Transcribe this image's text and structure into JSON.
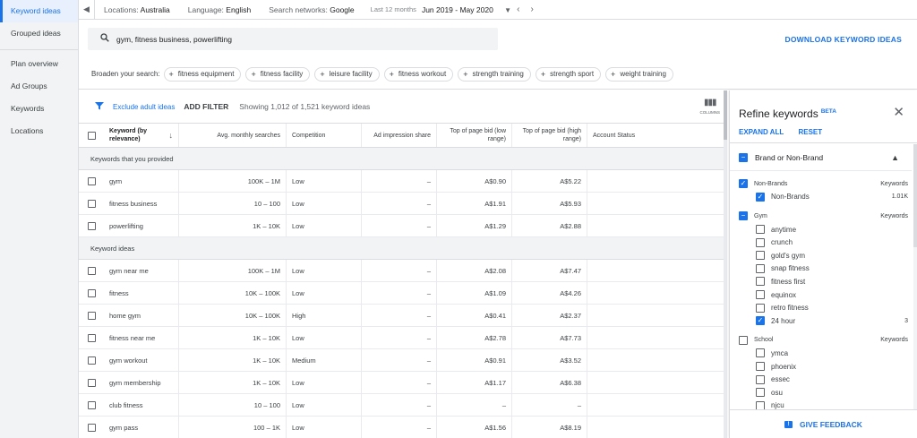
{
  "sidebar": {
    "items": [
      {
        "label": "Keyword ideas",
        "active": true
      },
      {
        "label": "Grouped ideas",
        "active": false
      },
      {
        "label": "Plan overview",
        "active": false
      },
      {
        "label": "Ad Groups",
        "active": false
      },
      {
        "label": "Keywords",
        "active": false
      },
      {
        "label": "Locations",
        "active": false
      }
    ]
  },
  "topbar": {
    "locations_key": "Locations:",
    "locations_val": "Australia",
    "language_key": "Language:",
    "language_val": "English",
    "networks_key": "Search networks:",
    "networks_val": "Google",
    "range_label": "Last 12 months",
    "range_value": "Jun 2019 - May 2020"
  },
  "search": {
    "value": "gym, fitness business, powerlifting"
  },
  "download_label": "DOWNLOAD KEYWORD IDEAS",
  "broaden": {
    "label": "Broaden your search:",
    "chips": [
      "fitness equipment",
      "fitness facility",
      "leisure facility",
      "fitness workout",
      "strength training",
      "strength sport",
      "weight training"
    ]
  },
  "filterbar": {
    "adult": "Exclude adult ideas",
    "add_filter": "ADD FILTER",
    "showing": "Showing 1,012 of 1,521 keyword ideas",
    "columns": "COLUMNS"
  },
  "table": {
    "headers": {
      "keyword": "Keyword (by relevance)",
      "searches": "Avg. monthly searches",
      "competition": "Competition",
      "impression": "Ad impression share",
      "bid_low": "Top of page bid (low range)",
      "bid_high": "Top of page bid (high range)",
      "status": "Account Status"
    },
    "group1": "Keywords that you provided",
    "provided": [
      {
        "kw": "gym",
        "s": "100K – 1M",
        "c": "Low",
        "i": "–",
        "lo": "A$0.90",
        "hi": "A$5.22"
      },
      {
        "kw": "fitness business",
        "s": "10 – 100",
        "c": "Low",
        "i": "–",
        "lo": "A$1.91",
        "hi": "A$5.93"
      },
      {
        "kw": "powerlifting",
        "s": "1K – 10K",
        "c": "Low",
        "i": "–",
        "lo": "A$1.29",
        "hi": "A$2.88"
      }
    ],
    "group2": "Keyword ideas",
    "ideas": [
      {
        "kw": "gym near me",
        "s": "100K – 1M",
        "c": "Low",
        "i": "–",
        "lo": "A$2.08",
        "hi": "A$7.47"
      },
      {
        "kw": "fitness",
        "s": "10K – 100K",
        "c": "Low",
        "i": "–",
        "lo": "A$1.09",
        "hi": "A$4.26"
      },
      {
        "kw": "home gym",
        "s": "10K – 100K",
        "c": "High",
        "i": "–",
        "lo": "A$0.41",
        "hi": "A$2.37"
      },
      {
        "kw": "fitness near me",
        "s": "1K – 10K",
        "c": "Low",
        "i": "–",
        "lo": "A$2.78",
        "hi": "A$7.73"
      },
      {
        "kw": "gym workout",
        "s": "1K – 10K",
        "c": "Medium",
        "i": "–",
        "lo": "A$0.91",
        "hi": "A$3.52"
      },
      {
        "kw": "gym membership",
        "s": "1K – 10K",
        "c": "Low",
        "i": "–",
        "lo": "A$1.17",
        "hi": "A$6.38"
      },
      {
        "kw": "club fitness",
        "s": "10 – 100",
        "c": "Low",
        "i": "–",
        "lo": "–",
        "hi": "–"
      },
      {
        "kw": "gym pass",
        "s": "100 – 1K",
        "c": "Low",
        "i": "–",
        "lo": "A$1.56",
        "hi": "A$8.19"
      }
    ]
  },
  "refine": {
    "title": "Refine keywords",
    "beta": "BETA",
    "expand": "EXPAND ALL",
    "reset": "RESET",
    "section": "Brand or Non-Brand",
    "groups": [
      {
        "name": "Non-Brands",
        "right": "Keywords",
        "checked": true,
        "items": [
          {
            "label": "Non-Brands",
            "checked": true,
            "count": "1.01K"
          }
        ]
      },
      {
        "name": "Gym",
        "right": "Keywords",
        "checked": "partial",
        "items": [
          {
            "label": "anytime",
            "checked": false,
            "count": ""
          },
          {
            "label": "crunch",
            "checked": false,
            "count": ""
          },
          {
            "label": "gold's gym",
            "checked": false,
            "count": ""
          },
          {
            "label": "snap fitness",
            "checked": false,
            "count": ""
          },
          {
            "label": "fitness first",
            "checked": false,
            "count": ""
          },
          {
            "label": "equinox",
            "checked": false,
            "count": ""
          },
          {
            "label": "retro fitness",
            "checked": false,
            "count": ""
          },
          {
            "label": "24 hour",
            "checked": true,
            "count": "3"
          }
        ]
      },
      {
        "name": "School",
        "right": "Keywords",
        "checked": false,
        "items": [
          {
            "label": "ymca",
            "checked": false,
            "count": ""
          },
          {
            "label": "phoenix",
            "checked": false,
            "count": ""
          },
          {
            "label": "essec",
            "checked": false,
            "count": ""
          },
          {
            "label": "osu",
            "checked": false,
            "count": ""
          },
          {
            "label": "njcu",
            "checked": false,
            "count": ""
          }
        ]
      }
    ],
    "feedback": "GIVE FEEDBACK"
  }
}
